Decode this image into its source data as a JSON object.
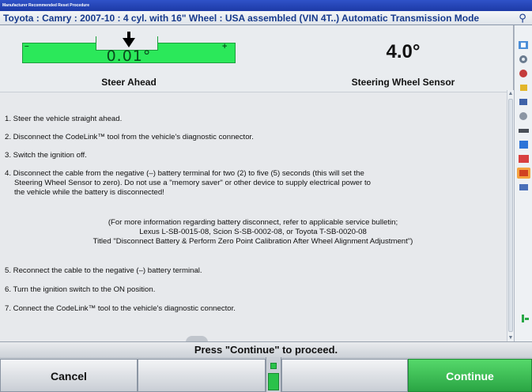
{
  "window": {
    "title": "Manufacturer Recommended Reset Procedure"
  },
  "vehicle": {
    "title": "Toyota : Camry : 2007-10 : 4 cyl. with 16\" Wheel : USA assembled (VIN 4T..) Automatic Transmission Mode",
    "help_icon": "help-icon"
  },
  "steer_gauge": {
    "value": "0.01°",
    "label": "Steer Ahead",
    "minus": "–",
    "plus": "+"
  },
  "sensor": {
    "value": "4.0°",
    "label": "Steering Wheel Sensor"
  },
  "steps": [
    "1. Steer the vehicle straight ahead.",
    "2. Disconnect the CodeLink™ tool from the vehicle's diagnostic connector.",
    "3. Switch the ignition off.",
    "4. Disconnect the cable from the negative (–) battery terminal for two (2) to five (5) seconds (this will set the",
    "Steering Wheel Sensor to zero). Do not use a \"memory saver\" or other device to supply electrical power to",
    "the vehicle while the battery is disconnected!",
    "5. Reconnect the cable to the negative (–) battery terminal.",
    "6. Turn the ignition switch to the ON position.",
    "7. Connect the CodeLink™ tool to the vehicle's diagnostic connector."
  ],
  "note": [
    "(For more information regarding battery disconnect, refer to applicable service bulletin;",
    "Lexus L-SB-0015-08, Scion S-SB-0002-08, or Toyota T-SB-0020-08",
    "Titled \"Disconnect Battery & Perform Zero Point Calibration After Wheel Alignment Adjustment\")"
  ],
  "status": {
    "text": "Press \"Continue\" to proceed."
  },
  "buttons": {
    "cancel": "Cancel",
    "continue": "Continue"
  },
  "colors": {
    "gauge_green": "#2be85a",
    "continue_green": "#2aa544"
  }
}
